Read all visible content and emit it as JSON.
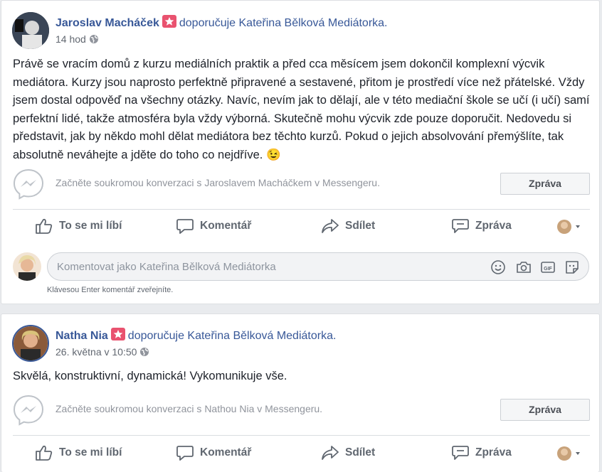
{
  "colors": {
    "link": "#385898",
    "badge": "#e9526f",
    "muted": "#616770"
  },
  "posts": [
    {
      "author": "Jaroslav Macháček",
      "recommends": "doporučuje Kateřina Bělková Mediátorka.",
      "time": "14 hod",
      "privacy_icon": "globe-icon",
      "text": "Právě se vracím domů z kurzu mediálních praktik a před cca měsícem jsem dokončil komplexní výcvik mediátora. Kurzy jsou naprosto perfektně připravené a sestavené, přitom je prostředí více než přátelské. Vždy jsem dostal odpověď na všechny otázky. Navíc, nevím jak to dělají, ale v této mediační škole se učí (i učí) samí perfektní lidé, takže atmosféra byla vždy výborná. Skutečně mohu výcvik zde pouze doporučit. Nedovedu si představit, jak by někdo mohl dělat mediátora bez těchto kurzů. Pokud o jejich absolvování přemýšlíte, tak absolutně neváhejte a jděte do toho co nejdříve.",
      "emoji": "😉",
      "messenger_text": "Začněte soukromou konverzaci s Jaroslavem Macháčkem v Messengeru.",
      "messenger_button": "Zpráva",
      "actions": {
        "like": "To se mi líbí",
        "comment": "Komentář",
        "share": "Sdílet",
        "message": "Zpráva"
      },
      "comment_placeholder": "Komentovat jako Kateřina Bělková Mediátorka",
      "comment_hint": "Klávesou Enter komentář zveřejníte."
    },
    {
      "author": "Natha Nia",
      "recommends": "doporučuje Kateřina Bělková Mediátorka.",
      "time": "26. května v 10:50",
      "privacy_icon": "globe-icon",
      "text": "Skvělá, konstruktivní, dynamická! Vykomunikuje vše.",
      "messenger_text": "Začněte soukromou konverzaci s Nathou Nia v Messengeru.",
      "messenger_button": "Zpráva",
      "actions": {
        "like": "To se mi líbí",
        "comment": "Komentář",
        "share": "Sdílet",
        "message": "Zpráva"
      }
    }
  ]
}
